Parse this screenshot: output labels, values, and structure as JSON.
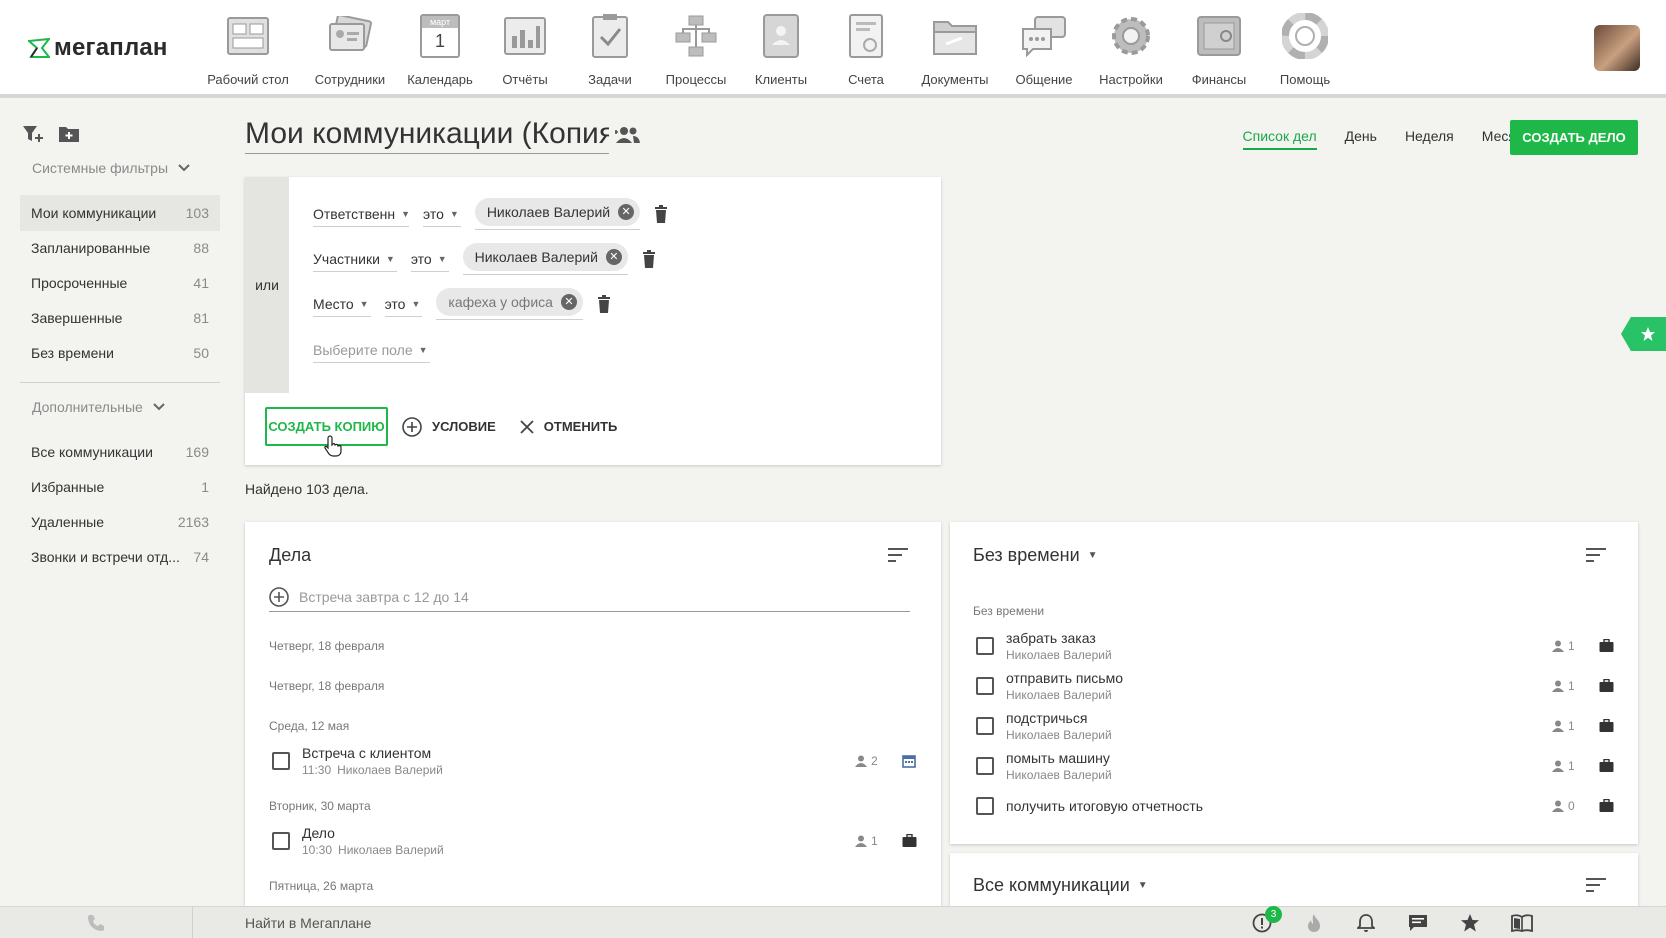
{
  "brand": {
    "logo_text": "мегаплан"
  },
  "nav": [
    {
      "label": "Рабочий стол",
      "icon": "desktop-icon"
    },
    {
      "label": "Сотрудники",
      "icon": "employees-icon"
    },
    {
      "label": "Календарь",
      "icon": "calendar-icon",
      "cal_month": "март",
      "cal_day": "1"
    },
    {
      "label": "Отчёты",
      "icon": "reports-icon"
    },
    {
      "label": "Задачи",
      "icon": "tasks-icon"
    },
    {
      "label": "Процессы",
      "icon": "processes-icon"
    },
    {
      "label": "Клиенты",
      "icon": "clients-icon"
    },
    {
      "label": "Счета",
      "icon": "invoices-icon"
    },
    {
      "label": "Документы",
      "icon": "documents-icon"
    },
    {
      "label": "Общение",
      "icon": "chat-icon"
    },
    {
      "label": "Настройки",
      "icon": "settings-icon"
    },
    {
      "label": "Финансы",
      "icon": "finance-icon"
    },
    {
      "label": "Помощь",
      "icon": "help-icon"
    }
  ],
  "sidebar": {
    "system_filters_label": "Системные фильтры",
    "system_items": [
      {
        "label": "Мои коммуникации",
        "count": "103",
        "active": true
      },
      {
        "label": "Запланированные",
        "count": "88"
      },
      {
        "label": "Просроченные",
        "count": "41"
      },
      {
        "label": "Завершенные",
        "count": "81"
      },
      {
        "label": "Без времени",
        "count": "50"
      }
    ],
    "extra_label": "Дополнительные",
    "extra_items": [
      {
        "label": "Все коммуникации",
        "count": "169"
      },
      {
        "label": "Избранные",
        "count": "1"
      },
      {
        "label": "Удаленные",
        "count": "2163"
      },
      {
        "label": "Звонки и встречи отд...",
        "count": "74"
      }
    ]
  },
  "header": {
    "title": "Мои коммуникации (Копия)",
    "view_tabs": [
      "Список дел",
      "День",
      "Неделя",
      "Месяц"
    ],
    "active_view": "Список дел",
    "create_button": "СОЗДАТЬ ДЕЛО"
  },
  "filter": {
    "or_label": "или",
    "conditions": [
      {
        "field": "Ответственн",
        "op": "это",
        "value": "Николаев Валерий"
      },
      {
        "field": "Участники",
        "op": "это",
        "value": "Николаев Валерий"
      },
      {
        "field": "Место",
        "op": "это",
        "value": "кафеха у офиса"
      }
    ],
    "select_field_placeholder": "Выберите поле",
    "copy_button": "СОЗДАТЬ КОПИЮ",
    "condition_button": "УСЛОВИЕ",
    "cancel_button": "ОТМЕНИТЬ"
  },
  "found_text": "Найдено 103 дела.",
  "tasks_card": {
    "title": "Дела",
    "quick_add_placeholder": "Встреча завтра с 12 до 14",
    "date_labels": [
      "Четверг, 18 февраля",
      "Четверг, 18 февраля",
      "Среда, 12 мая",
      "Вторник, 30 марта",
      "Пятница, 26 марта"
    ],
    "tasks": [
      {
        "name": "Встреча с клиентом",
        "time": "11:30",
        "owner": "Николаев Валерий",
        "participants": "2",
        "type_icon": "calendar-icon"
      },
      {
        "name": "Дело",
        "time": "10:30",
        "owner": "Николаев Валерий",
        "participants": "1",
        "type_icon": "briefcase-icon"
      }
    ]
  },
  "notime_card": {
    "title": "Без времени",
    "section_label": "Без времени",
    "tasks": [
      {
        "name": "забрать заказ",
        "owner": "Николаев Валерий",
        "participants": "1"
      },
      {
        "name": "отправить письмо",
        "owner": "Николаев Валерий",
        "participants": "1"
      },
      {
        "name": "подстричься",
        "owner": "Николаев Валерий",
        "participants": "1"
      },
      {
        "name": "помыть машину",
        "owner": "Николаев Валерий",
        "participants": "1"
      },
      {
        "name": "получить итоговую отчетность",
        "owner": "",
        "participants": "0"
      }
    ]
  },
  "all_card": {
    "title": "Все коммуникации"
  },
  "bottombar": {
    "search_placeholder": "Найти в Мегаплане",
    "notification_badge": "3"
  },
  "colors": {
    "accent": "#1eb848",
    "star_tab": "#2ac267"
  }
}
